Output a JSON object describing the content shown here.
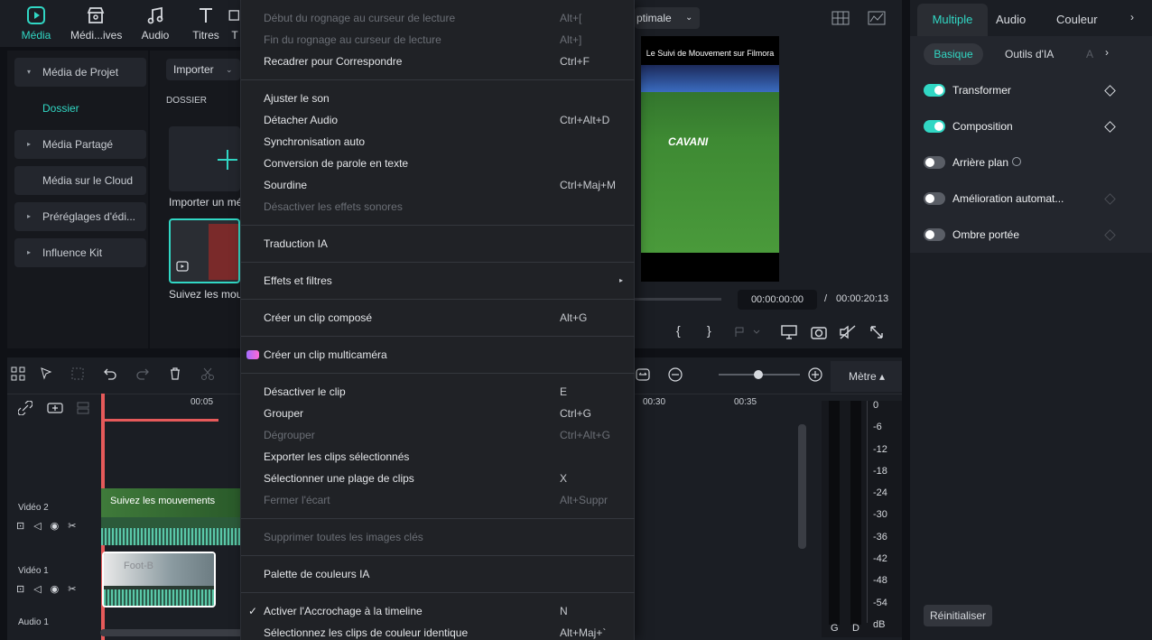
{
  "topnav": {
    "tabs": [
      {
        "label": "Média",
        "icon": "media-icon",
        "active": true
      },
      {
        "label": "Médi...ives",
        "icon": "stock-icon"
      },
      {
        "label": "Audio",
        "icon": "music-icon"
      },
      {
        "label": "Titres",
        "icon": "text-icon"
      },
      {
        "label": "T",
        "icon": "transitions-icon"
      }
    ]
  },
  "sidebar": {
    "items": [
      {
        "label": "Média de Projet",
        "arrow": "▾"
      },
      {
        "label": "Dossier"
      },
      {
        "label": "Média Partagé",
        "arrow": "▸"
      },
      {
        "label": "Média sur le Cloud"
      },
      {
        "label": "Préréglages d'édi...",
        "arrow": "▸"
      },
      {
        "label": "Influence Kit",
        "arrow": "▸"
      }
    ]
  },
  "media": {
    "import_label": "Importer",
    "folder_header": "DOSSIER",
    "import_tile_label": "Importer un mé",
    "clip_label": "Suivez les mou"
  },
  "menu": {
    "items": [
      {
        "label": "Début du rognage au curseur de lecture",
        "shortcut": "Alt+[",
        "disabled": true
      },
      {
        "label": "Fin du rognage au curseur de lecture",
        "shortcut": "Alt+]",
        "disabled": true
      },
      {
        "label": "Recadrer pour Correspondre",
        "shortcut": "Ctrl+F"
      },
      {
        "label": "Ajuster le son",
        "shortcut": ""
      },
      {
        "label": "Détacher Audio",
        "shortcut": "Ctrl+Alt+D"
      },
      {
        "label": "Synchronisation auto",
        "shortcut": ""
      },
      {
        "label": "Conversion de parole en texte",
        "shortcut": ""
      },
      {
        "label": "Sourdine",
        "shortcut": "Ctrl+Maj+M"
      },
      {
        "label": "Désactiver les effets sonores",
        "shortcut": "",
        "disabled": true
      },
      {
        "label": "Traduction IA",
        "shortcut": ""
      },
      {
        "label": "Effets et filtres",
        "shortcut": "",
        "submenu": true
      },
      {
        "label": "Créer un clip composé",
        "shortcut": "Alt+G"
      },
      {
        "label": "Créer un clip multicaméra",
        "shortcut": "",
        "badge": true
      },
      {
        "label": "Désactiver le clip",
        "shortcut": "E"
      },
      {
        "label": "Grouper",
        "shortcut": "Ctrl+G"
      },
      {
        "label": "Dégrouper",
        "shortcut": "Ctrl+Alt+G",
        "disabled": true
      },
      {
        "label": "Exporter les clips sélectionnés",
        "shortcut": ""
      },
      {
        "label": "Sélectionner une plage de clips",
        "shortcut": "X"
      },
      {
        "label": "Fermer l'écart",
        "shortcut": "Alt+Suppr",
        "disabled": true
      },
      {
        "label": "Supprimer toutes les images clés",
        "shortcut": "",
        "disabled": true
      },
      {
        "label": "Palette de couleurs IA",
        "shortcut": ""
      },
      {
        "label": "Activer l'Accrochage à la timeline",
        "shortcut": "N",
        "checked": true
      },
      {
        "label": "Sélectionnez les clips de couleur identique",
        "shortcut": "Alt+Maj+`"
      }
    ]
  },
  "player": {
    "quality": "ptimale",
    "overlay_title": "Le Suivi de Mouvement sur Filmora",
    "player_name": "CAVANI",
    "current_time": "00:00:00:00",
    "separator": "/",
    "total_time": "00:00:20:13"
  },
  "right": {
    "tabs": [
      "Multiple",
      "Audio",
      "Couleur"
    ],
    "subtabs": [
      "Basique",
      "Outils d'IA",
      "A"
    ],
    "props": [
      {
        "label": "Transformer",
        "on": true
      },
      {
        "label": "Composition",
        "on": true
      },
      {
        "label": "Arrière plan",
        "on": false
      },
      {
        "label": "Amélioration automat...",
        "on": false
      },
      {
        "label": "Ombre portée",
        "on": false
      }
    ],
    "reset_label": "Réinitialiser"
  },
  "timeline": {
    "ruler": [
      "00:05",
      "00:30",
      "00:35"
    ],
    "tracks": [
      "Vidéo 2",
      "Vidéo 1",
      "Audio 1"
    ],
    "clip_v2": "Suivez les mouvements",
    "clip_v1": "Foot-B",
    "meter_label": "Mètre",
    "db_scale": [
      "0",
      "-6",
      "-12",
      "-18",
      "-24",
      "-30",
      "-36",
      "-42",
      "-48",
      "-54",
      "dB"
    ],
    "channels": [
      "G",
      "D"
    ]
  }
}
